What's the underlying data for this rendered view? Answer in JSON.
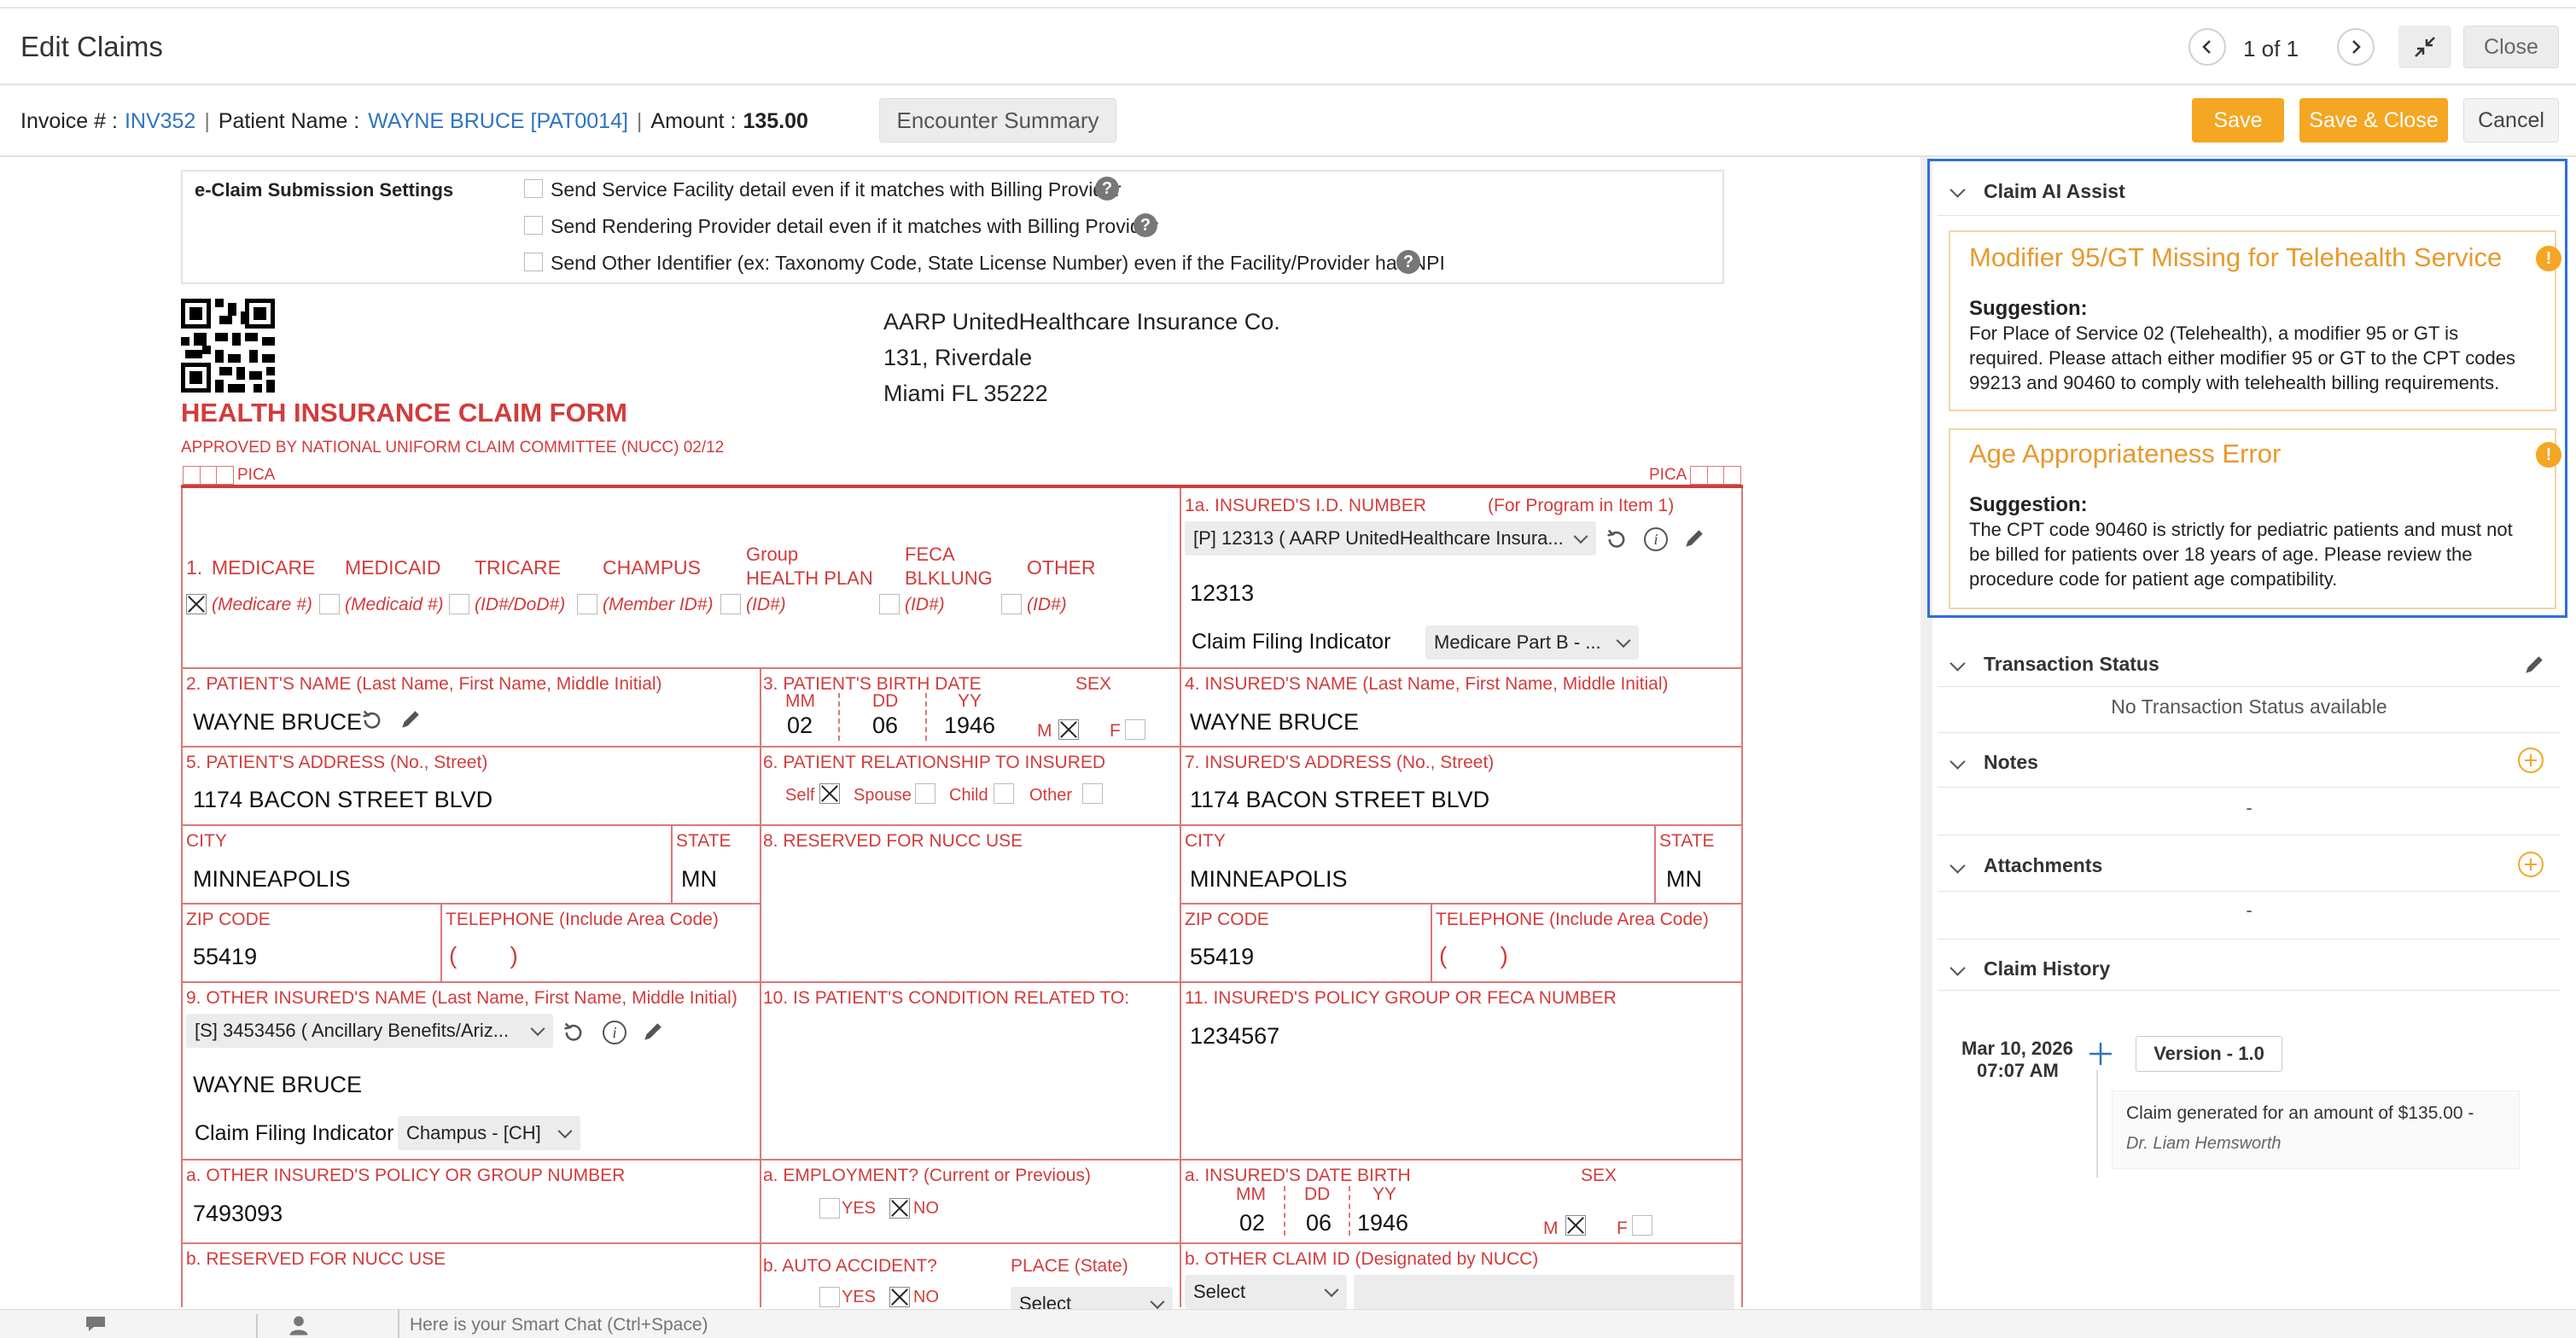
{
  "window": {
    "title": "Edit Claims",
    "pagination": "1 of 1",
    "close_label": "Close"
  },
  "header": {
    "invoice_label": "Invoice # :",
    "invoice_value": "INV352",
    "patient_label": "Patient Name :",
    "patient_value": "WAYNE BRUCE [PAT0014]",
    "amount_label": "Amount :",
    "amount_value": "135.00",
    "encounter_summary": "Encounter Summary",
    "save": "Save",
    "save_close": "Save & Close",
    "cancel": "Cancel"
  },
  "esettings": {
    "title": "e-Claim Submission Settings",
    "opt1": "Send Service Facility detail even if it matches with Billing Provider",
    "opt2": "Send Rendering Provider detail even if it matches with Billing Provider",
    "opt3": "Send Other Identifier (ex: Taxonomy Code, State License Number) even if the Facility/Provider has NPI"
  },
  "insurer": {
    "name": "AARP UnitedHealthcare Insurance Co.",
    "line1": "131, Riverdale",
    "line2": "Miami FL 35222"
  },
  "form": {
    "title": "HEALTH INSURANCE CLAIM FORM",
    "approved": "APPROVED BY NATIONAL UNIFORM CLAIM COMMITTEE (NUCC) 02/12",
    "pica": "PICA",
    "b1": {
      "num": "1.",
      "medicare": "MEDICARE",
      "medicaid": "MEDICAID",
      "tricare": "TRICARE",
      "champus": "CHAMPUS",
      "group1": "Group",
      "group2": "HEALTH PLAN",
      "feca1": "FECA",
      "feca2": "BLKLUNG",
      "other": "OTHER",
      "medicare_id": "(Medicare #)",
      "medicaid_id": "(Medicaid #)",
      "tricare_id": "(ID#/DoD#)",
      "champus_id": "(Member ID#)",
      "group_id": "(ID#)",
      "feca_id": "(ID#)",
      "other_id": "(ID#)"
    },
    "b1a": {
      "label": "1a. INSURED'S I.D. NUMBER",
      "program": "(For Program in Item 1)",
      "select": "[P] 12313 ( AARP UnitedHealthcare Insura...",
      "value": "12313",
      "cfi_label": "Claim Filing Indicator",
      "cfi_value": "Medicare Part B - ..."
    },
    "b2": {
      "label": "2. PATIENT'S NAME (Last Name, First Name, Middle Initial)",
      "value": "WAYNE BRUCE"
    },
    "b3": {
      "label": "3. PATIENT'S BIRTH DATE",
      "sex": "SEX",
      "mm_l": "MM",
      "dd_l": "DD",
      "yy_l": "YY",
      "mm": "02",
      "dd": "06",
      "yy": "1946",
      "m": "M",
      "f": "F"
    },
    "b4": {
      "label": "4. INSURED'S NAME (Last Name, First Name, Middle Initial)",
      "value": "WAYNE BRUCE"
    },
    "b5": {
      "label": "5. PATIENT'S ADDRESS (No., Street)",
      "value": "1174 BACON STREET BLVD",
      "city_l": "CITY",
      "city": "MINNEAPOLIS",
      "state_l": "STATE",
      "state": "MN",
      "zip_l": "ZIP CODE",
      "zip": "55419",
      "tel_l": "TELEPHONE (Include Area Code)",
      "tel": "(        )"
    },
    "b6": {
      "label": "6. PATIENT RELATIONSHIP TO INSURED",
      "self": "Self",
      "spouse": "Spouse",
      "child": "Child",
      "other": "Other"
    },
    "b7": {
      "label": "7. INSURED'S ADDRESS (No., Street)",
      "value": "1174 BACON STREET BLVD",
      "city_l": "CITY",
      "city": "MINNEAPOLIS",
      "state_l": "STATE",
      "state": "MN",
      "zip_l": "ZIP CODE",
      "zip": "55419",
      "tel_l": "TELEPHONE (Include Area Code)",
      "tel": "(        )"
    },
    "b8": {
      "label": "8. RESERVED FOR NUCC USE"
    },
    "b9": {
      "label": "9. OTHER INSURED'S NAME (Last Name, First Name, Middle Initial)",
      "select": "[S] 3453456 ( Ancillary Benefits/Ariz...",
      "value": "WAYNE BRUCE",
      "cfi_label": "Claim Filing Indicator",
      "cfi_value": "Champus - [CH]",
      "a_label": "a. OTHER INSURED'S POLICY OR GROUP NUMBER",
      "a_value": "7493093",
      "b_label": "b. RESERVED FOR NUCC USE"
    },
    "b10": {
      "label": "10. IS PATIENT'S CONDITION RELATED TO:",
      "a_label": "a. EMPLOYMENT? (Current or Previous)",
      "yes": "YES",
      "no": "NO",
      "b_label": "b. AUTO ACCIDENT?",
      "place": "PLACE (State)",
      "select": "Select"
    },
    "b11": {
      "label": "11. INSURED'S POLICY GROUP OR FECA NUMBER",
      "value": "1234567",
      "a_label": "a. INSURED'S DATE BIRTH",
      "sex": "SEX",
      "mm_l": "MM",
      "dd_l": "DD",
      "yy_l": "YY",
      "mm": "02",
      "dd": "06",
      "yy": "1946",
      "m": "M",
      "f": "F",
      "b_label": "b. OTHER CLAIM ID (Designated by NUCC)",
      "select": "Select"
    }
  },
  "sidebar": {
    "ai_title": "Claim AI Assist",
    "alerts": [
      {
        "title": "Modifier 95/GT Missing for Telehealth Service",
        "sugg": "Suggestion:",
        "l1": "For Place of Service 02 (Telehealth), a modifier 95 or GT is",
        "l2": "required. Please attach either modifier 95 or GT to the CPT codes",
        "l3": "99213 and 90460 to comply with telehealth billing requirements."
      },
      {
        "title": "Age Appropriateness Error",
        "sugg": "Suggestion:",
        "l1": "The CPT code 90460 is strictly for pediatric patients and must not",
        "l2": "be billed for patients over 18 years of age. Please review the",
        "l3": "procedure code for patient age compatibility."
      }
    ],
    "warn_glyph": "!",
    "transaction_title": "Transaction Status",
    "transaction_empty": "No Transaction Status available",
    "notes_title": "Notes",
    "notes_empty": "-",
    "attachments_title": "Attachments",
    "attachments_empty": "-",
    "history_title": "Claim History",
    "history_date": "Mar 10, 2026",
    "history_time": "07:07 AM",
    "history_version": "Version - 1.0",
    "history_text": "Claim generated for an amount of $135.00 -",
    "history_user": "Dr. Liam Hemsworth"
  },
  "chat": {
    "placeholder": "Here is your Smart Chat (Ctrl+Space)"
  },
  "colors": {
    "accent": "#f5a623",
    "form_red": "#d23c3c",
    "link_blue": "#2f74c0",
    "highlight": "#2e6fd9"
  }
}
